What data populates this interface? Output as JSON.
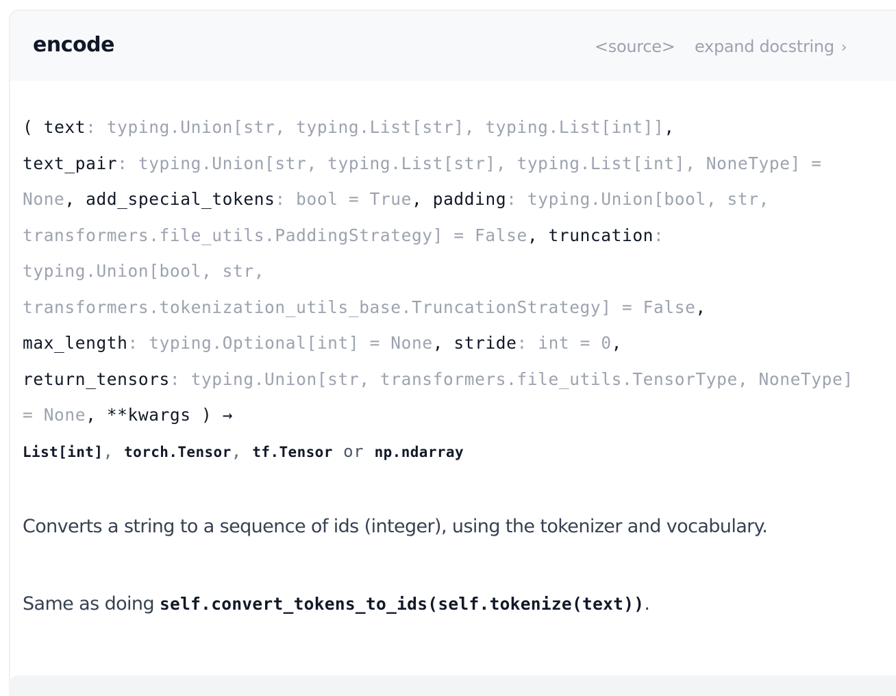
{
  "header": {
    "function_name": "encode",
    "source_label": "<source>",
    "expand_label": "expand docstring",
    "expand_chevron": "›"
  },
  "signature": {
    "open_paren": "(",
    "params": [
      {
        "name": "text",
        "annotation": ": typing.Union[str, typing.List[str], typing.List[int]]",
        "sep": ","
      },
      {
        "name": "text_pair",
        "annotation": ": typing.Union[str, typing.List[str], typing.List[int], NoneType] = None",
        "sep": ","
      },
      {
        "name": "add_special_tokens",
        "annotation": ": bool = True",
        "sep": ","
      },
      {
        "name": "padding",
        "annotation": ": typing.Union[bool, str, transformers.file_utils.PaddingStrategy] = False",
        "sep": ","
      },
      {
        "name": "truncation",
        "annotation": ": typing.Union[bool, str, transformers.tokenization_utils_base.TruncationStrategy] = False",
        "sep": ","
      },
      {
        "name": "max_length",
        "annotation": ": typing.Optional[int] = None",
        "sep": ","
      },
      {
        "name": "stride",
        "annotation": ": int = 0",
        "sep": ","
      },
      {
        "name": "return_tensors",
        "annotation": ": typing.Union[str, transformers.file_utils.TensorType, NoneType] = None",
        "sep": ","
      },
      {
        "name": "**kwargs",
        "annotation": "",
        "sep": ""
      }
    ],
    "close_paren": ")",
    "arrow": "→",
    "returns": [
      "List[int]",
      "torch.Tensor",
      "tf.Tensor",
      "np.ndarray"
    ],
    "returns_sep": ",",
    "returns_or": "or"
  },
  "description": {
    "line1": "Converts a string to a sequence of ids (integer), using the tokenizer and vocabulary.",
    "line2_prefix": "Same as doing ",
    "line2_code": "self.convert_tokens_to_ids(self.tokenize(text))",
    "line2_suffix": "."
  }
}
